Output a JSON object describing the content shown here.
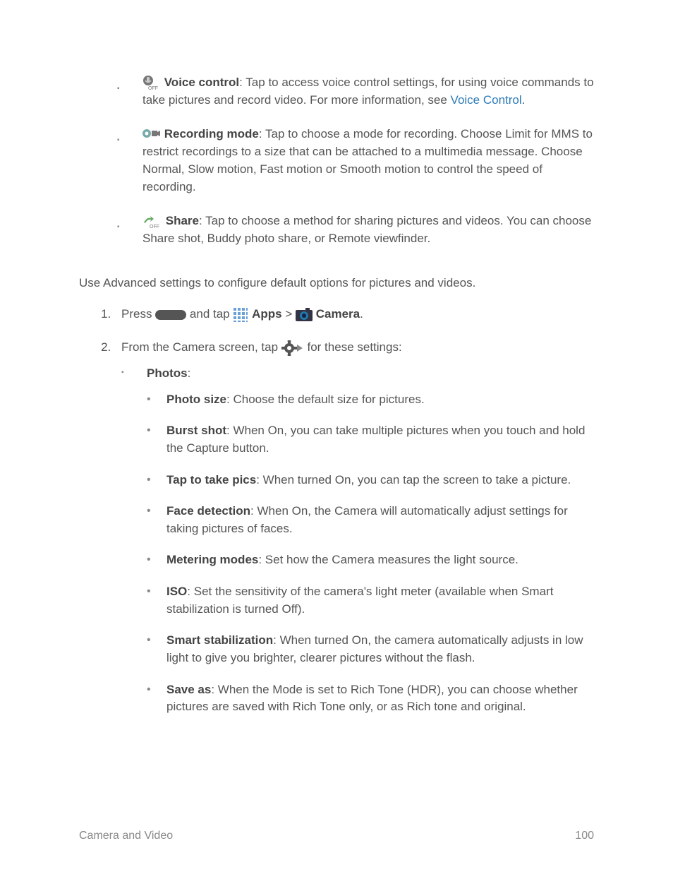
{
  "top_items": [
    {
      "title": "Voice control",
      "text_before_link": ": Tap to access voice control settings, for using voice commands to take pictures and record video. For more information, see ",
      "link_text": "Voice Control",
      "text_after_link": "."
    },
    {
      "title": "Recording mode",
      "text": ": Tap to choose a mode for recording. Choose Limit for MMS to restrict recordings to a size that can be attached to a multimedia message. Choose Normal, Slow motion, Fast motion or Smooth motion to control the speed of recording."
    },
    {
      "title": "Share",
      "text": ": Tap to choose a method for sharing pictures and videos. You can choose Share shot, Buddy photo share, or Remote viewfinder."
    }
  ],
  "advanced_intro": "Use Advanced settings to configure default options for pictures and videos.",
  "step1": {
    "press": "Press ",
    "and_tap": " and tap ",
    "apps": "Apps",
    "gt": " > ",
    "camera": "Camera",
    "period": "."
  },
  "step2": {
    "from": "From the Camera screen, tap ",
    "for_settings": " for these settings:"
  },
  "photos_label": "Photos",
  "photo_items": [
    {
      "title": "Photo size",
      "text": ": Choose the default size for pictures."
    },
    {
      "title": "Burst shot",
      "text": ": When On, you can take multiple pictures when you touch and hold the Capture button."
    },
    {
      "title": "Tap to take pics",
      "text": ": When turned On, you can tap the screen to take a picture."
    },
    {
      "title": "Face detection",
      "text": ": When On, the Camera will automatically adjust settings for taking pictures of faces."
    },
    {
      "title": "Metering modes",
      "text": ": Set how the Camera measures the light source."
    },
    {
      "title": "ISO",
      "text": ": Set the sensitivity of the camera's light meter (available when Smart stabilization is turned Off)."
    },
    {
      "title": "Smart stabilization",
      "text": ": When turned On, the camera automatically adjusts in low light to give you brighter, clearer pictures without the flash."
    },
    {
      "title": "Save as",
      "text": ": When the Mode is set to Rich Tone (HDR), you can choose whether pictures are saved with Rich Tone only, or as Rich tone and original."
    }
  ],
  "footer": {
    "section": "Camera and Video",
    "page": "100"
  }
}
